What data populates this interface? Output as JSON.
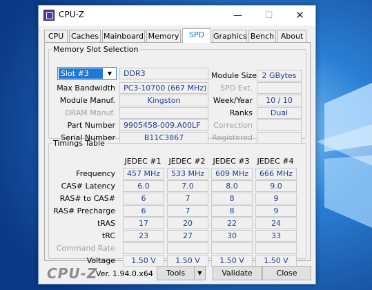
{
  "window": {
    "title": "CPU-Z",
    "min": "—",
    "max": "☐",
    "close": "✕"
  },
  "tabs": [
    "CPU",
    "Caches",
    "Mainboard",
    "Memory",
    "SPD",
    "Graphics",
    "Bench",
    "About"
  ],
  "active_tab": "SPD",
  "slot": {
    "legend": "Memory Slot Selection",
    "selected": "Slot #3",
    "type": "DDR3",
    "labels": {
      "max_bandwidth": "Max Bandwidth",
      "module_manuf": "Module Manuf.",
      "dram_manuf": "DRAM Manuf.",
      "part_number": "Part Number",
      "serial_number": "Serial Number",
      "module_size": "Module Size",
      "spd_ext": "SPD Ext.",
      "week_year": "Week/Year",
      "ranks": "Ranks",
      "correction": "Correction",
      "registered": "Registered"
    },
    "max_bandwidth": "PC3-10700 (667 MHz)",
    "module_manuf": "Kingston",
    "dram_manuf": "",
    "part_number": "9905458-009.A00LF",
    "serial_number": "B11C3867",
    "module_size": "2 GBytes",
    "spd_ext": "",
    "week_year": "10 / 10",
    "ranks": "Dual",
    "correction": "",
    "registered": ""
  },
  "timings": {
    "legend": "Timings Table",
    "columns": [
      "JEDEC #1",
      "JEDEC #2",
      "JEDEC #3",
      "JEDEC #4"
    ],
    "rows": [
      {
        "label": "Frequency",
        "values": [
          "457 MHz",
          "533 MHz",
          "609 MHz",
          "666 MHz"
        ],
        "disabled": false
      },
      {
        "label": "CAS# Latency",
        "values": [
          "6.0",
          "7.0",
          "8.0",
          "9.0"
        ],
        "disabled": false
      },
      {
        "label": "RAS# to CAS#",
        "values": [
          "6",
          "7",
          "8",
          "9"
        ],
        "disabled": false
      },
      {
        "label": "RAS# Precharge",
        "values": [
          "6",
          "7",
          "8",
          "9"
        ],
        "disabled": false
      },
      {
        "label": "tRAS",
        "values": [
          "17",
          "20",
          "22",
          "24"
        ],
        "disabled": false
      },
      {
        "label": "tRC",
        "values": [
          "23",
          "27",
          "30",
          "33"
        ],
        "disabled": false
      },
      {
        "label": "Command Rate",
        "values": [
          "",
          "",
          "",
          ""
        ],
        "disabled": true
      },
      {
        "label": "Voltage",
        "values": [
          "1.50 V",
          "1.50 V",
          "1.50 V",
          "1.50 V"
        ],
        "disabled": false
      }
    ]
  },
  "footer": {
    "logo": "CPU-Z",
    "version": "Ver. 1.94.0.x64",
    "tools": "Tools",
    "validate": "Validate",
    "close": "Close"
  }
}
